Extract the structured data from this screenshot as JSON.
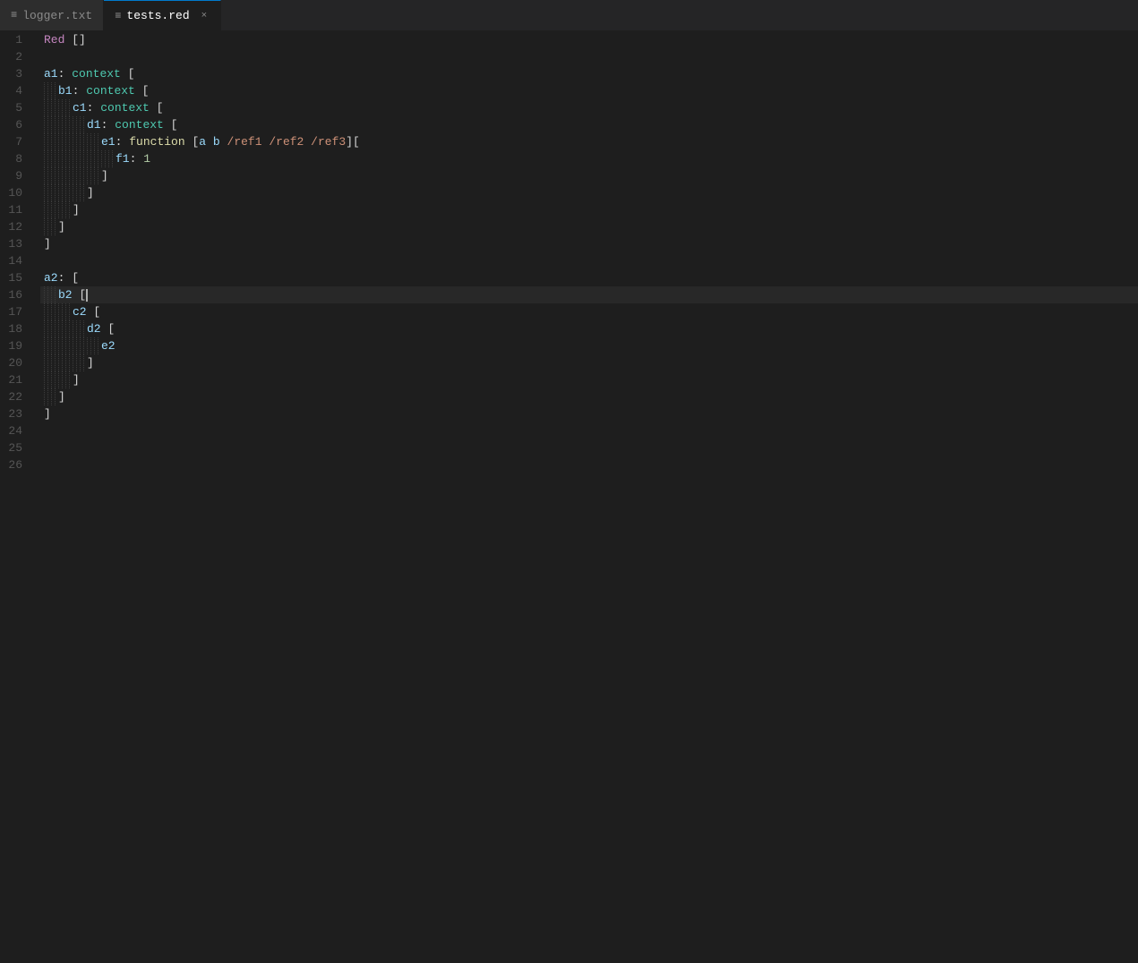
{
  "tabs": [
    {
      "id": "logger",
      "label": "logger.txt",
      "icon": "≡",
      "active": false,
      "closeable": false
    },
    {
      "id": "tests-red",
      "label": "tests.red",
      "icon": "≡",
      "active": true,
      "closeable": true
    }
  ],
  "editor": {
    "lines": [
      {
        "num": 1,
        "indent": 0,
        "content": "Red []",
        "tokens": [
          {
            "type": "kw-red",
            "text": "Red"
          },
          {
            "type": "kw-bracket",
            "text": " []"
          }
        ]
      },
      {
        "num": 2,
        "indent": 0,
        "content": "",
        "tokens": []
      },
      {
        "num": 3,
        "indent": 0,
        "content": "a1: context [",
        "tokens": [
          {
            "type": "kw-key",
            "text": "a1"
          },
          {
            "type": "kw-colon",
            "text": ":"
          },
          {
            "type": "plain",
            "text": " "
          },
          {
            "type": "kw-context",
            "text": "context"
          },
          {
            "type": "kw-bracket",
            "text": " ["
          }
        ]
      },
      {
        "num": 4,
        "indent": 1,
        "content": "    b1: context [",
        "tokens": [
          {
            "type": "kw-key",
            "text": "b1"
          },
          {
            "type": "kw-colon",
            "text": ":"
          },
          {
            "type": "plain",
            "text": " "
          },
          {
            "type": "kw-context",
            "text": "context"
          },
          {
            "type": "kw-bracket",
            "text": " ["
          }
        ]
      },
      {
        "num": 5,
        "indent": 2,
        "content": "        c1: context [",
        "tokens": [
          {
            "type": "kw-key",
            "text": "c1"
          },
          {
            "type": "kw-colon",
            "text": ":"
          },
          {
            "type": "plain",
            "text": " "
          },
          {
            "type": "kw-context",
            "text": "context"
          },
          {
            "type": "kw-bracket",
            "text": " ["
          }
        ]
      },
      {
        "num": 6,
        "indent": 3,
        "content": "            d1: context [",
        "tokens": [
          {
            "type": "kw-key",
            "text": "d1"
          },
          {
            "type": "kw-colon",
            "text": ":"
          },
          {
            "type": "plain",
            "text": " "
          },
          {
            "type": "kw-context",
            "text": "context"
          },
          {
            "type": "kw-bracket",
            "text": " ["
          }
        ]
      },
      {
        "num": 7,
        "indent": 4,
        "content": "                e1: function [a b /ref1 /ref2 /ref3][",
        "tokens": [
          {
            "type": "kw-key",
            "text": "e1"
          },
          {
            "type": "kw-colon",
            "text": ":"
          },
          {
            "type": "plain",
            "text": " "
          },
          {
            "type": "kw-function",
            "text": "function"
          },
          {
            "type": "kw-bracket",
            "text": " ["
          },
          {
            "type": "kw-param",
            "text": "a"
          },
          {
            "type": "plain",
            "text": " "
          },
          {
            "type": "kw-param",
            "text": "b"
          },
          {
            "type": "plain",
            "text": " "
          },
          {
            "type": "kw-ref",
            "text": "/ref1"
          },
          {
            "type": "plain",
            "text": " "
          },
          {
            "type": "kw-ref",
            "text": "/ref2"
          },
          {
            "type": "plain",
            "text": " "
          },
          {
            "type": "kw-ref",
            "text": "/ref3"
          },
          {
            "type": "kw-bracket",
            "text": "]["
          }
        ]
      },
      {
        "num": 8,
        "indent": 5,
        "content": "                    f1: 1",
        "tokens": [
          {
            "type": "kw-field",
            "text": "f1"
          },
          {
            "type": "kw-colon",
            "text": ":"
          },
          {
            "type": "plain",
            "text": " "
          },
          {
            "type": "kw-number",
            "text": "1"
          }
        ]
      },
      {
        "num": 9,
        "indent": 4,
        "content": "                ]",
        "tokens": [
          {
            "type": "kw-bracket",
            "text": "]"
          }
        ]
      },
      {
        "num": 10,
        "indent": 3,
        "content": "            ]",
        "tokens": [
          {
            "type": "kw-bracket",
            "text": "]"
          }
        ]
      },
      {
        "num": 11,
        "indent": 2,
        "content": "        ]",
        "tokens": [
          {
            "type": "kw-bracket",
            "text": "]"
          }
        ]
      },
      {
        "num": 12,
        "indent": 1,
        "content": "    ]",
        "tokens": [
          {
            "type": "kw-bracket",
            "text": "]"
          }
        ]
      },
      {
        "num": 13,
        "indent": 0,
        "content": "]",
        "tokens": [
          {
            "type": "kw-bracket",
            "text": "]"
          }
        ]
      },
      {
        "num": 14,
        "indent": 0,
        "content": "",
        "tokens": []
      },
      {
        "num": 15,
        "indent": 0,
        "content": "a2: [",
        "tokens": [
          {
            "type": "kw-key",
            "text": "a2"
          },
          {
            "type": "kw-colon",
            "text": ":"
          },
          {
            "type": "kw-bracket",
            "text": " ["
          }
        ]
      },
      {
        "num": 16,
        "indent": 1,
        "content": "    b2 [",
        "tokens": [
          {
            "type": "kw-key",
            "text": "b2"
          },
          {
            "type": "plain",
            "text": " "
          },
          {
            "type": "kw-bracket",
            "text": "["
          }
        ],
        "cursor": true
      },
      {
        "num": 17,
        "indent": 2,
        "content": "        c2 [",
        "tokens": [
          {
            "type": "kw-key",
            "text": "c2"
          },
          {
            "type": "plain",
            "text": " "
          },
          {
            "type": "kw-bracket",
            "text": "["
          }
        ]
      },
      {
        "num": 18,
        "indent": 3,
        "content": "            d2 [",
        "tokens": [
          {
            "type": "kw-key",
            "text": "d2"
          },
          {
            "type": "plain",
            "text": " "
          },
          {
            "type": "kw-bracket",
            "text": "["
          }
        ]
      },
      {
        "num": 19,
        "indent": 4,
        "content": "                e2",
        "tokens": [
          {
            "type": "kw-key",
            "text": "e2"
          }
        ]
      },
      {
        "num": 20,
        "indent": 3,
        "content": "            ]",
        "tokens": [
          {
            "type": "kw-bracket",
            "text": "]"
          }
        ]
      },
      {
        "num": 21,
        "indent": 2,
        "content": "        ]",
        "tokens": [
          {
            "type": "kw-bracket",
            "text": "]"
          }
        ]
      },
      {
        "num": 22,
        "indent": 1,
        "content": "    ]",
        "tokens": [
          {
            "type": "kw-bracket",
            "text": "]"
          }
        ]
      },
      {
        "num": 23,
        "indent": 0,
        "content": "]",
        "tokens": [
          {
            "type": "kw-bracket",
            "text": "]"
          }
        ]
      },
      {
        "num": 24,
        "indent": 0,
        "content": "",
        "tokens": []
      },
      {
        "num": 25,
        "indent": 0,
        "content": "",
        "tokens": []
      },
      {
        "num": 26,
        "indent": 0,
        "content": "",
        "tokens": []
      }
    ]
  }
}
